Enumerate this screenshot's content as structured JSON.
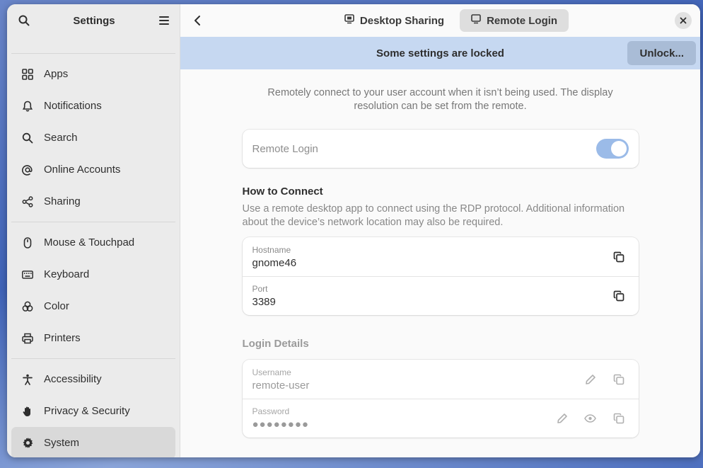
{
  "sidebar": {
    "title": "Settings",
    "items": [
      {
        "label": "Apps",
        "icon": "apps-icon"
      },
      {
        "label": "Notifications",
        "icon": "bell-icon"
      },
      {
        "label": "Search",
        "icon": "search-icon"
      },
      {
        "label": "Online Accounts",
        "icon": "at-icon"
      },
      {
        "label": "Sharing",
        "icon": "share-icon"
      },
      {
        "label": "Mouse & Touchpad",
        "icon": "mouse-icon"
      },
      {
        "label": "Keyboard",
        "icon": "keyboard-icon"
      },
      {
        "label": "Color",
        "icon": "color-icon"
      },
      {
        "label": "Printers",
        "icon": "printer-icon"
      },
      {
        "label": "Accessibility",
        "icon": "accessibility-icon"
      },
      {
        "label": "Privacy & Security",
        "icon": "hand-icon"
      },
      {
        "label": "System",
        "icon": "gear-icon"
      }
    ]
  },
  "header": {
    "tabs": [
      {
        "label": "Desktop Sharing",
        "active": false
      },
      {
        "label": "Remote Login",
        "active": true
      }
    ]
  },
  "banner": {
    "text": "Some settings are locked",
    "unlock_label": "Unlock..."
  },
  "main": {
    "description": "Remotely connect to your user account when it isn’t being used. The display resolution can be set from the remote.",
    "toggle": {
      "label": "Remote Login",
      "on": true
    },
    "connect": {
      "title": "How to Connect",
      "description": "Use a remote desktop app to connect using the RDP protocol. Additional information about the device’s network location may also be required.",
      "hostname_label": "Hostname",
      "hostname_value": "gnome46",
      "port_label": "Port",
      "port_value": "3389"
    },
    "login": {
      "title": "Login Details",
      "username_label": "Username",
      "username_value": "remote-user",
      "password_label": "Password",
      "password_value": "●●●●●●●●"
    }
  },
  "colors": {
    "banner_bg": "#c6d8f1",
    "switch_on": "#9bbbe8",
    "sidebar_bg": "#ebebeb"
  }
}
